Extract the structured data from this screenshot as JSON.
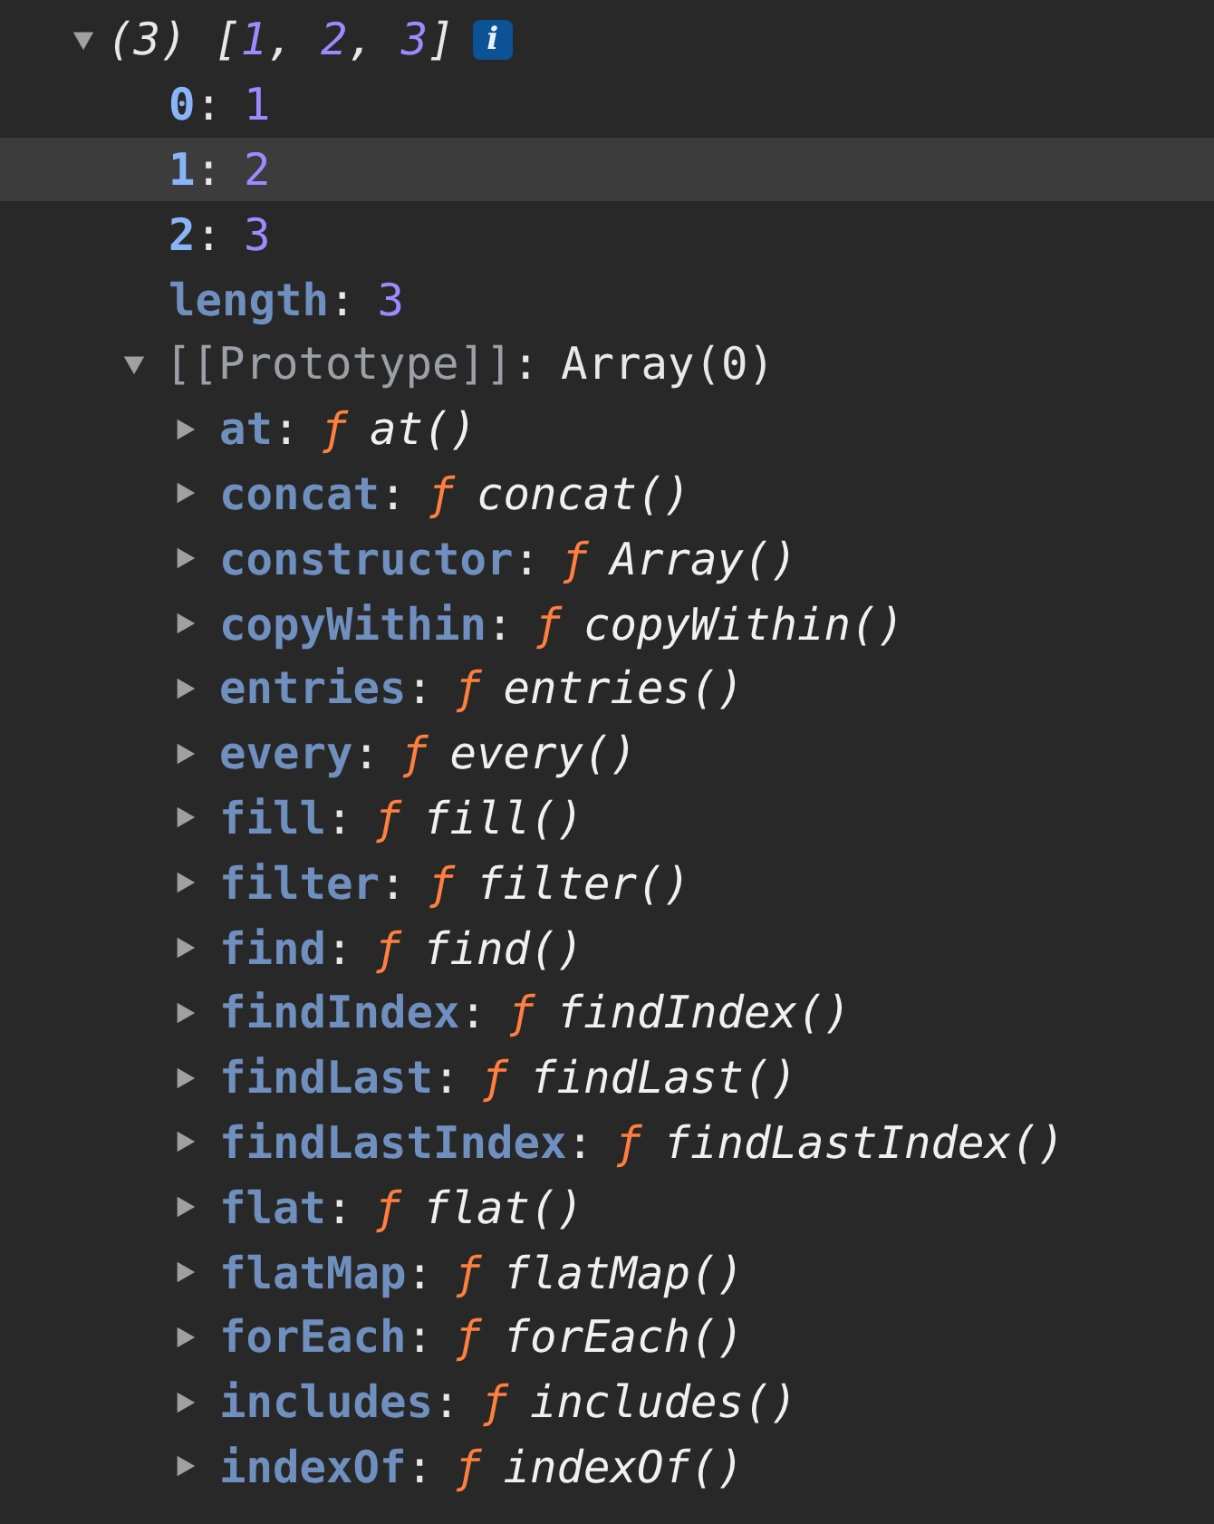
{
  "key_separator": ":",
  "root": {
    "expanded": true,
    "selected": false,
    "count": "(3)",
    "preview": {
      "open": "[",
      "items": [
        "1",
        "2",
        "3"
      ],
      "separator": ", ",
      "close": "]"
    },
    "info_badge": "i",
    "children": [
      {
        "key": "0",
        "value": "1",
        "kind": "number",
        "enumerable": true,
        "selected": false
      },
      {
        "key": "1",
        "value": "2",
        "kind": "number",
        "enumerable": true,
        "selected": true
      },
      {
        "key": "2",
        "value": "3",
        "kind": "number",
        "enumerable": true,
        "selected": false
      },
      {
        "key": "length",
        "value": "3",
        "kind": "number",
        "enumerable": false,
        "selected": false
      },
      {
        "key": "[[Prototype]]",
        "value": "Array(0)",
        "kind": "internal",
        "expanded": true,
        "selected": false,
        "children": [
          {
            "key": "at",
            "fn_mark": "ƒ",
            "value": "at()",
            "kind": "function",
            "enumerable": false,
            "expanded": false,
            "selected": false
          },
          {
            "key": "concat",
            "fn_mark": "ƒ",
            "value": "concat()",
            "kind": "function",
            "enumerable": false,
            "expanded": false,
            "selected": false
          },
          {
            "key": "constructor",
            "fn_mark": "ƒ",
            "value": "Array()",
            "kind": "function",
            "enumerable": false,
            "expanded": false,
            "selected": false
          },
          {
            "key": "copyWithin",
            "fn_mark": "ƒ",
            "value": "copyWithin()",
            "kind": "function",
            "enumerable": false,
            "expanded": false,
            "selected": false
          },
          {
            "key": "entries",
            "fn_mark": "ƒ",
            "value": "entries()",
            "kind": "function",
            "enumerable": false,
            "expanded": false,
            "selected": false
          },
          {
            "key": "every",
            "fn_mark": "ƒ",
            "value": "every()",
            "kind": "function",
            "enumerable": false,
            "expanded": false,
            "selected": false
          },
          {
            "key": "fill",
            "fn_mark": "ƒ",
            "value": "fill()",
            "kind": "function",
            "enumerable": false,
            "expanded": false,
            "selected": false
          },
          {
            "key": "filter",
            "fn_mark": "ƒ",
            "value": "filter()",
            "kind": "function",
            "enumerable": false,
            "expanded": false,
            "selected": false
          },
          {
            "key": "find",
            "fn_mark": "ƒ",
            "value": "find()",
            "kind": "function",
            "enumerable": false,
            "expanded": false,
            "selected": false
          },
          {
            "key": "findIndex",
            "fn_mark": "ƒ",
            "value": "findIndex()",
            "kind": "function",
            "enumerable": false,
            "expanded": false,
            "selected": false
          },
          {
            "key": "findLast",
            "fn_mark": "ƒ",
            "value": "findLast()",
            "kind": "function",
            "enumerable": false,
            "expanded": false,
            "selected": false
          },
          {
            "key": "findLastIndex",
            "fn_mark": "ƒ",
            "value": "findLastIndex()",
            "kind": "function",
            "enumerable": false,
            "expanded": false,
            "selected": false
          },
          {
            "key": "flat",
            "fn_mark": "ƒ",
            "value": "flat()",
            "kind": "function",
            "enumerable": false,
            "expanded": false,
            "selected": false
          },
          {
            "key": "flatMap",
            "fn_mark": "ƒ",
            "value": "flatMap()",
            "kind": "function",
            "enumerable": false,
            "expanded": false,
            "selected": false
          },
          {
            "key": "forEach",
            "fn_mark": "ƒ",
            "value": "forEach()",
            "kind": "function",
            "enumerable": false,
            "expanded": false,
            "selected": false
          },
          {
            "key": "includes",
            "fn_mark": "ƒ",
            "value": "includes()",
            "kind": "function",
            "enumerable": false,
            "expanded": false,
            "selected": false
          },
          {
            "key": "indexOf",
            "fn_mark": "ƒ",
            "value": "indexOf()",
            "kind": "function",
            "enumerable": false,
            "expanded": false,
            "selected": false
          }
        ]
      }
    ]
  }
}
